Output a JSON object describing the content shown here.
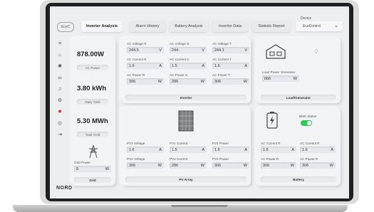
{
  "app": {
    "logo": "EcoC"
  },
  "tabs": [
    {
      "label": "Inverter Analysis"
    },
    {
      "label": "Alarm History"
    },
    {
      "label": "Battery Analysis"
    },
    {
      "label": "Invertor Data"
    },
    {
      "label": "Statistic Report"
    }
  ],
  "device": {
    "label": "Device",
    "value": "EcoControl"
  },
  "sidebar": {
    "icons": [
      "menu-icon",
      "home-icon",
      "gear-icon",
      "sliders-icon",
      "bell-icon",
      "settings-icon",
      "alert-icon",
      "info-icon",
      "logout-icon"
    ]
  },
  "brand": {
    "name": "NORD"
  },
  "power": {
    "value": "878.00W",
    "label": "AC Power"
  },
  "daily": {
    "value": "3.80 kWh",
    "label": "Daily Yield"
  },
  "total": {
    "value": "5.30 MWh",
    "label": "Total Yield"
  },
  "grid": {
    "label": "Grid Power",
    "value": "8",
    "unit": "W",
    "title": "Grid"
  },
  "inverter": {
    "title": "Inverter",
    "fields": [
      {
        "label": "AC Voltage R",
        "value": "244.5",
        "unit": "V"
      },
      {
        "label": "AC Voltage S",
        "value": "244",
        "unit": "V"
      },
      {
        "label": "AC Voltage T",
        "value": "244.1",
        "unit": "V"
      },
      {
        "label": "AC Current R",
        "value": "1.6",
        "unit": "A"
      },
      {
        "label": "AC Current C",
        "value": "1.5",
        "unit": "A"
      },
      {
        "label": "AC Current T",
        "value": "1.6",
        "unit": "A"
      },
      {
        "label": "AC Power R",
        "value": "306",
        "unit": "W"
      },
      {
        "label": "AC Power S",
        "value": "286",
        "unit": "W"
      },
      {
        "label": "AC Power T",
        "value": "306",
        "unit": "W"
      }
    ]
  },
  "load": {
    "label": "Load Power Generator",
    "value": "866",
    "unit": "W",
    "title": "Load/Generator"
  },
  "pv": {
    "title": "PV Array",
    "fields": [
      {
        "label": "PV1 Voltage",
        "value": "1.6",
        "unit": "A"
      },
      {
        "label": "PV1 Current",
        "value": "1.5",
        "unit": "A"
      },
      {
        "label": "PV1 Power",
        "value": "1.6",
        "unit": "A"
      },
      {
        "label": "PV2 Voltage",
        "value": "306",
        "unit": "W"
      },
      {
        "label": "PV2 Current",
        "value": "286",
        "unit": "W"
      },
      {
        "label": "PV2 Power",
        "value": "306",
        "unit": "W"
      }
    ]
  },
  "battery": {
    "title": "Battery",
    "status_label": "BMS Status",
    "status_on": true,
    "fields": [
      {
        "label": "AC Current R",
        "value": "1.6",
        "unit": "A"
      },
      {
        "label": "AC Current R",
        "value": "1.6",
        "unit": "A"
      },
      {
        "label": "AC Power R",
        "value": "306",
        "unit": "W"
      },
      {
        "label": "AC Power R",
        "value": "306",
        "unit": "W"
      }
    ]
  },
  "colors": {
    "accent": "#2ecc55",
    "background": "#edeef0",
    "card": "#f2f3f5"
  }
}
